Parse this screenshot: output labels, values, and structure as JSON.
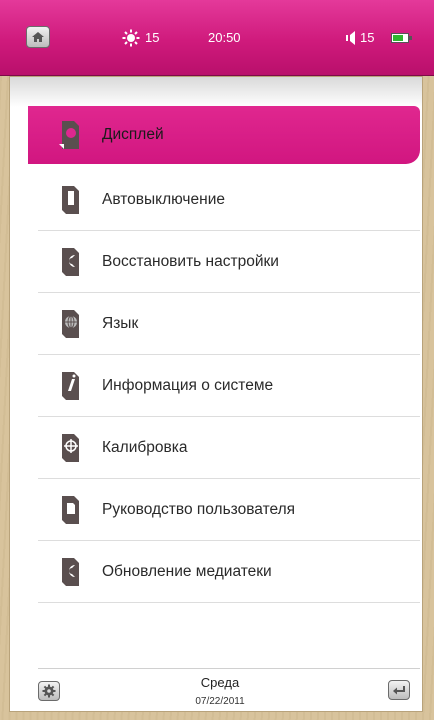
{
  "statusbar": {
    "brightness": "15",
    "time": "20:50",
    "volume": "15",
    "home_icon": "home-icon",
    "brightness_icon": "sun-icon",
    "volume_icon": "speaker-icon",
    "battery_icon": "battery-icon",
    "battery_level": 0.6
  },
  "menu": {
    "items": [
      {
        "label": "Дисплей",
        "icon": "display-icon",
        "active": true
      },
      {
        "label": "Автовыключение",
        "icon": "auto-off-icon",
        "active": false
      },
      {
        "label": "Восстановить настройки",
        "icon": "restore-icon",
        "active": false
      },
      {
        "label": "Язык",
        "icon": "language-icon",
        "active": false
      },
      {
        "label": "Информация о системе",
        "icon": "info-icon",
        "active": false
      },
      {
        "label": "Калибровка",
        "icon": "calibration-icon",
        "active": false
      },
      {
        "label": "Руководство пользователя",
        "icon": "manual-icon",
        "active": false
      },
      {
        "label": "Обновление медиатеки",
        "icon": "update-icon",
        "active": false
      }
    ]
  },
  "footer": {
    "day": "Среда",
    "date": "07/22/2011",
    "settings_icon": "gear-icon",
    "back_icon": "back-icon"
  },
  "colors": {
    "accent": "#d11680",
    "frame": "#d8c39c"
  }
}
